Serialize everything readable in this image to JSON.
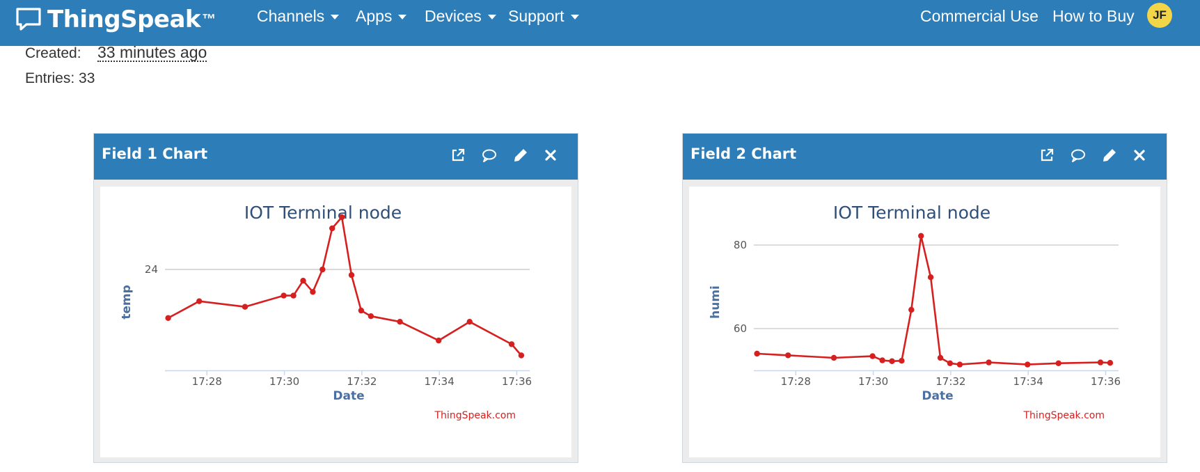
{
  "navbar": {
    "brand": "ThingSpeak",
    "brand_tm": "™",
    "menus": [
      {
        "label": "Channels"
      },
      {
        "label": "Apps"
      },
      {
        "label": "Devices"
      },
      {
        "label": "Support"
      }
    ],
    "right_links": [
      {
        "label": "Commercial Use"
      },
      {
        "label": "How to Buy"
      }
    ],
    "avatar_initials": "JF"
  },
  "channel_info": {
    "created_label": "Created:",
    "created_value": "33 minutes ago",
    "entries_label": "Entries: 33"
  },
  "colors": {
    "primary": "#2d7db8",
    "series": "#d62020",
    "axis_title": "#4a6fa0",
    "watermark": "#d62020"
  },
  "panels": [
    {
      "title": "Field 1 Chart",
      "controls": [
        {
          "name": "external-link-icon"
        },
        {
          "name": "comment-icon"
        },
        {
          "name": "pencil-icon"
        },
        {
          "name": "close-icon"
        }
      ]
    },
    {
      "title": "Field 2 Chart",
      "controls": [
        {
          "name": "external-link-icon"
        },
        {
          "name": "comment-icon"
        },
        {
          "name": "pencil-icon"
        },
        {
          "name": "close-icon"
        }
      ]
    }
  ],
  "chart_data": [
    {
      "type": "line",
      "title": "IOT Terminal node",
      "xlabel": "Date",
      "ylabel": "temp",
      "watermark": "ThingSpeak.com",
      "grid": true,
      "xlim": [
        "17:26:55",
        "17:36:20"
      ],
      "ylim": [
        21.3,
        25.1
      ],
      "y_ticks": [
        24
      ],
      "x_ticks": [
        "17:28",
        "17:30",
        "17:32",
        "17:34",
        "17:36"
      ],
      "series": [
        {
          "x": [
            "17:27:00",
            "17:27:48",
            "17:28:59",
            "17:29:59",
            "17:30:14",
            "17:30:29",
            "17:30:44",
            "17:30:59",
            "17:31:14",
            "17:31:29",
            "17:31:44",
            "17:31:59",
            "17:32:14",
            "17:32:59",
            "17:33:59",
            "17:34:47",
            "17:35:52",
            "17:36:07"
          ],
          "y": [
            22.7,
            23.15,
            23.0,
            23.3,
            23.3,
            23.7,
            23.4,
            24.0,
            25.1,
            25.4,
            23.85,
            22.9,
            22.75,
            22.6,
            22.1,
            22.6,
            22.0,
            21.7
          ]
        }
      ]
    },
    {
      "type": "line",
      "title": "IOT Terminal node",
      "xlabel": "Date",
      "ylabel": "humi",
      "watermark": "ThingSpeak.com",
      "grid": true,
      "xlim": [
        "17:26:55",
        "17:36:20"
      ],
      "ylim": [
        50,
        84
      ],
      "y_ticks": [
        60,
        80
      ],
      "x_ticks": [
        "17:28",
        "17:30",
        "17:32",
        "17:34",
        "17:36"
      ],
      "series": [
        {
          "x": [
            "17:27:00",
            "17:27:48",
            "17:28:59",
            "17:29:59",
            "17:30:14",
            "17:30:29",
            "17:30:44",
            "17:30:59",
            "17:31:14",
            "17:31:29",
            "17:31:44",
            "17:31:59",
            "17:32:14",
            "17:32:59",
            "17:33:59",
            "17:34:47",
            "17:35:52",
            "17:36:07"
          ],
          "y": [
            54.0,
            53.6,
            53.0,
            53.4,
            52.4,
            52.2,
            52.3,
            64.5,
            82.2,
            72.3,
            53.0,
            51.7,
            51.4,
            51.9,
            51.4,
            51.7,
            51.9,
            51.8
          ]
        }
      ]
    }
  ]
}
